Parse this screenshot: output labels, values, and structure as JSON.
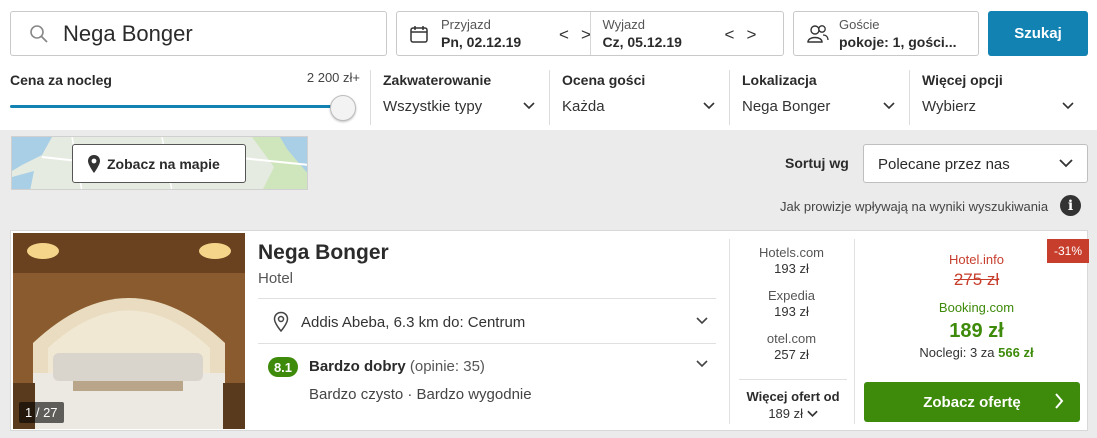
{
  "search": {
    "destination": "Nega Bonger"
  },
  "dates": {
    "checkin_label": "Przyjazd",
    "checkin_value": "Pn, 02.12.19",
    "checkout_label": "Wyjazd",
    "checkout_value": "Cz, 05.12.19",
    "prev": "<",
    "next": ">"
  },
  "guests": {
    "label": "Goście",
    "value": "pokoje: 1, gości..."
  },
  "search_button": "Szukaj",
  "filters": {
    "price_title": "Cena za nocleg",
    "price_value": "2 200 zł+",
    "price_slider_level": 1.0,
    "accommodation_title": "Zakwaterowanie",
    "accommodation_value": "Wszystkie typy",
    "rating_title": "Ocena gości",
    "rating_value": "Każda",
    "location_title": "Lokalizacja",
    "location_value": "Nega Bonger",
    "more_title": "Więcej opcji",
    "more_value": "Wybierz"
  },
  "map_button": "Zobacz na mapie",
  "sort": {
    "label": "Sortuj wg",
    "value": "Polecane przez nas"
  },
  "commission_note": "Jak prowizje wpływają na wyniki wyszukiwania",
  "info_icon": "i",
  "hotel": {
    "name": "Nega Bonger",
    "type": "Hotel",
    "photo_count": "1 / 27",
    "location": "Addis Abeba, 6.3 km do: Centrum",
    "rating_score": "8.1",
    "rating_text": "Bardzo dobry",
    "rating_reviews": "(opinie: 35)",
    "tags": "Bardzo czysto · Bardzo wygodnie",
    "offers": [
      {
        "site": "Hotels.com",
        "price": "193 zł"
      },
      {
        "site": "Expedia",
        "price": "193 zł"
      },
      {
        "site": "otel.com",
        "price": "257 zł"
      }
    ],
    "more_offers_label": "Więcej ofert od",
    "more_offers_price": "189 zł",
    "discount": "-31%",
    "deal_site_old": "Hotel.info",
    "deal_price_old": "275 zł",
    "deal_site": "Booking.com",
    "deal_price": "189 zł",
    "deal_nights_prefix": "Noclegi: 3 za",
    "deal_nights_total": "566 zł",
    "cta": "Zobacz ofertę"
  },
  "colors": {
    "primary": "#1282b2",
    "green": "#3e8a0b",
    "red": "#c73e2d"
  }
}
